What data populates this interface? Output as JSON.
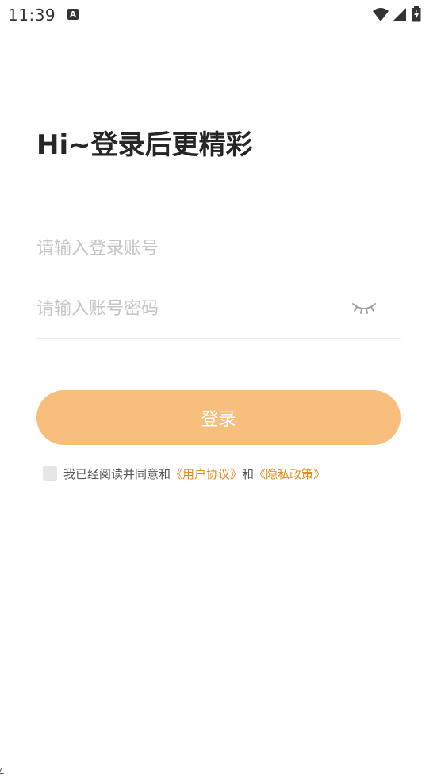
{
  "status_bar": {
    "time": "11:39",
    "notification_icon": "A",
    "icons": [
      "wifi-icon",
      "signal-icon",
      "battery-charging-icon"
    ]
  },
  "title": "Hi~登录后更精彩",
  "account_field": {
    "placeholder": "请输入登录账号",
    "value": ""
  },
  "password_field": {
    "placeholder": "请输入账号密码",
    "value": "",
    "toggle_icon": "eye-closed-icon"
  },
  "login_button": {
    "label": "登录"
  },
  "agreement": {
    "checked": false,
    "prefix": "我已经阅读并同意和",
    "user_agreement": "《用户协议》",
    "connector": "和",
    "privacy_policy": "《隐私政策》"
  },
  "colors": {
    "accent": "#f7be7c",
    "link": "#e38a1c",
    "placeholder": "#c4c4c4",
    "title": "#262626"
  }
}
